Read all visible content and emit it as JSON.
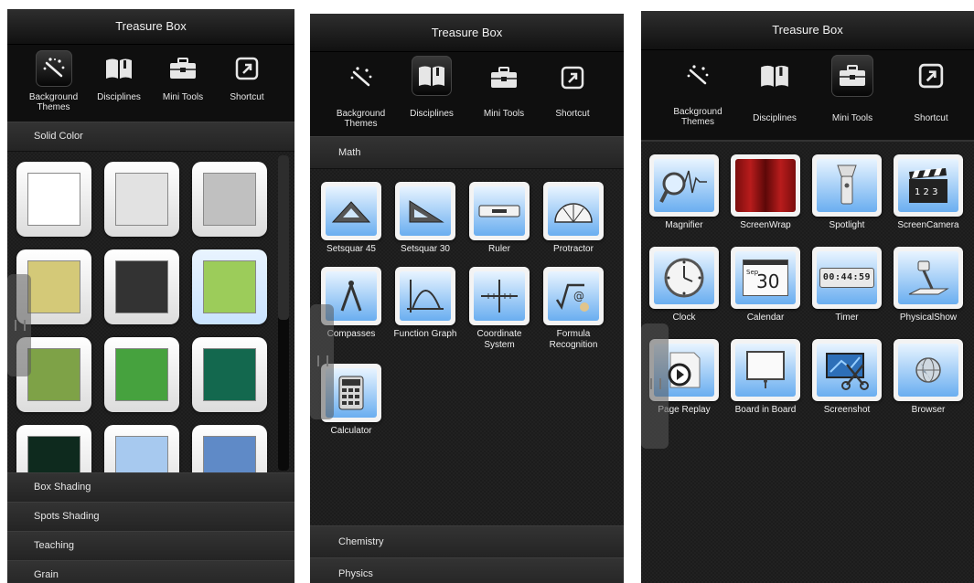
{
  "panel1": {
    "title": "Treasure Box",
    "tabs": [
      {
        "label": "Background Themes",
        "icon": "wand-sparkle-icon",
        "active": true
      },
      {
        "label": "Disciplines",
        "icon": "book-icon",
        "active": false
      },
      {
        "label": "Mini Tools",
        "icon": "toolbox-icon",
        "active": false
      },
      {
        "label": "Shortcut",
        "icon": "shortcut-arrow-icon",
        "active": false
      }
    ],
    "section_open": "Solid Color",
    "swatches": [
      "#ffffff",
      "#e2e2e2",
      "#c0c0c0",
      "#d4c978",
      "#333333",
      "#9ccc5a",
      "#7ea247",
      "#46a23e",
      "#13684e",
      "#0e2a1e",
      "#a7c9ef",
      "#5f8ac7"
    ],
    "selected_swatch": 5,
    "sections_closed": [
      "Box Shading",
      "Spots Shading",
      "Teaching",
      "Grain"
    ]
  },
  "panel2": {
    "title": "Treasure Box",
    "tabs": [
      {
        "label": "Background Themes",
        "icon": "wand-sparkle-icon",
        "active": false
      },
      {
        "label": "Disciplines",
        "icon": "book-icon",
        "active": true
      },
      {
        "label": "Mini Tools",
        "icon": "toolbox-icon",
        "active": false
      },
      {
        "label": "Shortcut",
        "icon": "shortcut-arrow-icon",
        "active": false
      }
    ],
    "section_open": "Math",
    "tools": [
      {
        "label": "Setsquar 45",
        "icon": "setsquare-45-icon"
      },
      {
        "label": "Setsquar 30",
        "icon": "setsquare-30-icon"
      },
      {
        "label": "Ruler",
        "icon": "ruler-icon"
      },
      {
        "label": "Protractor",
        "icon": "protractor-icon"
      },
      {
        "label": "Compasses",
        "icon": "compasses-icon"
      },
      {
        "label": "Function Graph",
        "icon": "function-graph-icon"
      },
      {
        "label": "Coordinate System",
        "icon": "coordinate-system-icon"
      },
      {
        "label": "Formula Recognition",
        "icon": "formula-recognition-icon"
      },
      {
        "label": "Calculator",
        "icon": "calculator-icon"
      }
    ],
    "sections_closed": [
      "Chemistry",
      "Physics"
    ]
  },
  "panel3": {
    "title": "Treasure Box",
    "tabs": [
      {
        "label": "Background Themes",
        "icon": "wand-sparkle-icon",
        "active": false
      },
      {
        "label": "Disciplines",
        "icon": "book-icon",
        "active": false
      },
      {
        "label": "Mini Tools",
        "icon": "toolbox-icon",
        "active": true
      },
      {
        "label": "Shortcut",
        "icon": "shortcut-arrow-icon",
        "active": false
      }
    ],
    "tools": [
      {
        "label": "Magnifier",
        "icon": "magnifier-icon"
      },
      {
        "label": "ScreenWrap",
        "icon": "curtain-icon"
      },
      {
        "label": "Spotlight",
        "icon": "spotlight-icon"
      },
      {
        "label": "ScreenCamera",
        "icon": "clapperboard-icon"
      },
      {
        "label": "Clock",
        "icon": "clock-icon"
      },
      {
        "label": "Calendar",
        "icon": "calendar-icon"
      },
      {
        "label": "Timer",
        "icon": "timer-icon"
      },
      {
        "label": "PhysicalShow",
        "icon": "document-camera-icon"
      },
      {
        "label": "Page Replay",
        "icon": "page-replay-icon"
      },
      {
        "label": "Board in Board",
        "icon": "board-icon"
      },
      {
        "label": "Screenshot",
        "icon": "scissors-icon"
      },
      {
        "label": "Browser",
        "icon": "globe-icon"
      }
    ],
    "calendar_month": "Sep",
    "calendar_day": "30",
    "timer_readout": "00:44:59",
    "clapper_digits": "1 2 3"
  }
}
